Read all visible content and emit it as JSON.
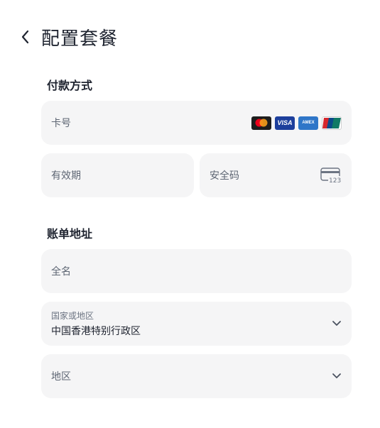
{
  "header": {
    "title": "配置套餐",
    "back_icon": "chevron-left-icon"
  },
  "payment": {
    "section_title": "付款方式",
    "card_number_placeholder": "卡号",
    "card_brands": [
      "mastercard",
      "visa",
      "amex",
      "unionpay"
    ],
    "amex_text": "AMEX",
    "visa_text": "VISA",
    "expiry_placeholder": "有效期",
    "cvc_placeholder": "安全码",
    "cvc_icon_text": "123"
  },
  "billing": {
    "section_title": "账单地址",
    "full_name_placeholder": "全名",
    "country_label": "国家或地区",
    "country_value": "中国香港特别行政区",
    "region_placeholder": "地区"
  },
  "colors": {
    "field_bg": "#f5f5f6",
    "label": "#5d6573"
  }
}
